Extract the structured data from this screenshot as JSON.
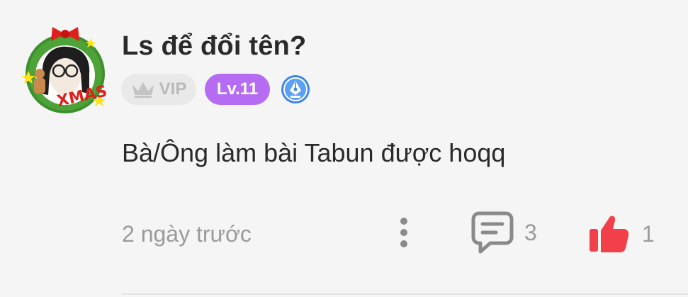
{
  "comment": {
    "username": "Ls để đổi tên?",
    "badges": {
      "vip_label": "VIP",
      "level_label": "Lv.11"
    },
    "text": "Bà/Ông làm bài Tabun được hoqq",
    "timestamp": "2 ngày trước",
    "reply_count": "3",
    "like_count": "1",
    "liked": true
  },
  "colors": {
    "background": "#f5f5f5",
    "level_badge": "#b66cf2",
    "like_active": "#f2404a",
    "muted_text": "#9b9b9b"
  },
  "icons": {
    "avatar": "avatar",
    "vip": "crown-icon",
    "writer_badge": "pen-nib-icon",
    "more": "more-vertical-icon",
    "reply": "comment-icon",
    "like": "thumbs-up-icon"
  }
}
